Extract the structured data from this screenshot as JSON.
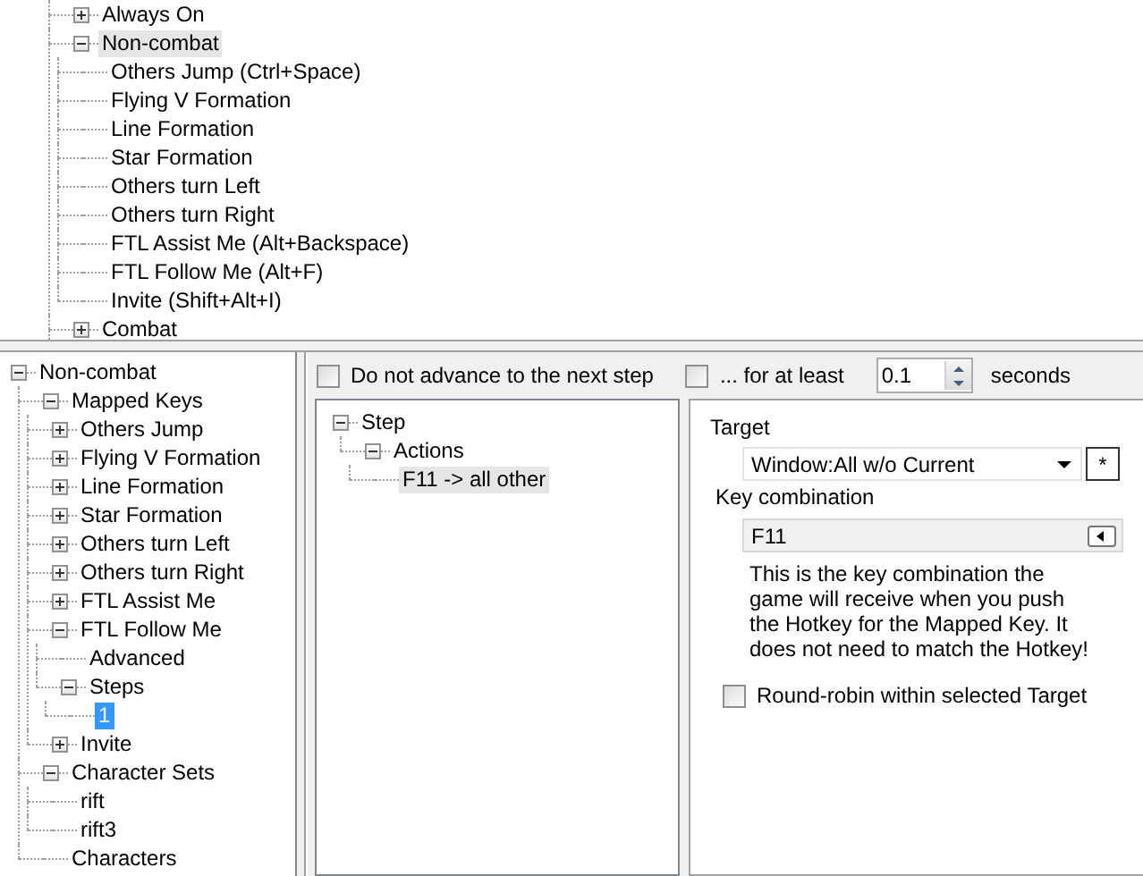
{
  "hotkey_tree": {
    "focused": false,
    "items": [
      {
        "label": "Always On",
        "kind": "folder",
        "expanded": false,
        "selected": false
      },
      {
        "label": "Non-combat",
        "kind": "folder",
        "expanded": true,
        "selected": true,
        "children": [
          {
            "label": "Others Jump (Ctrl+Space)",
            "kind": "leaf",
            "selected": false
          },
          {
            "label": "Flying V Formation",
            "kind": "leaf",
            "selected": false
          },
          {
            "label": "Line Formation",
            "kind": "leaf",
            "selected": false
          },
          {
            "label": "Star Formation",
            "kind": "leaf",
            "selected": false
          },
          {
            "label": "Others turn Left",
            "kind": "leaf",
            "selected": false
          },
          {
            "label": "Others turn Right",
            "kind": "leaf",
            "selected": false
          },
          {
            "label": "FTL Assist Me (Alt+Backspace)",
            "kind": "leaf",
            "selected": false
          },
          {
            "label": "FTL Follow Me (Alt+F)",
            "kind": "leaf",
            "selected": false
          },
          {
            "label": "Invite (Shift+Alt+I)",
            "kind": "leaf",
            "selected": false
          }
        ]
      },
      {
        "label": "Combat",
        "kind": "folder",
        "expanded": false,
        "selected": false
      }
    ]
  },
  "config_tree": {
    "focused": true,
    "items": [
      {
        "label": "Non-combat",
        "kind": "folder",
        "expanded": true,
        "selected": false,
        "children": [
          {
            "label": "Mapped Keys",
            "kind": "folder",
            "expanded": true,
            "selected": false,
            "children": [
              {
                "label": "Others Jump",
                "kind": "folder",
                "expanded": false,
                "selected": false
              },
              {
                "label": "Flying V Formation",
                "kind": "folder",
                "expanded": false,
                "selected": false
              },
              {
                "label": "Line Formation",
                "kind": "folder",
                "expanded": false,
                "selected": false
              },
              {
                "label": "Star Formation",
                "kind": "folder",
                "expanded": false,
                "selected": false
              },
              {
                "label": "Others turn Left",
                "kind": "folder",
                "expanded": false,
                "selected": false
              },
              {
                "label": "Others turn Right",
                "kind": "folder",
                "expanded": false,
                "selected": false
              },
              {
                "label": "FTL Assist Me",
                "kind": "folder",
                "expanded": false,
                "selected": false
              },
              {
                "label": "FTL Follow Me",
                "kind": "folder",
                "expanded": true,
                "selected": false,
                "children": [
                  {
                    "label": "Advanced",
                    "kind": "leaf",
                    "selected": false
                  },
                  {
                    "label": "Steps",
                    "kind": "folder",
                    "expanded": true,
                    "selected": false,
                    "children": [
                      {
                        "label": "1",
                        "kind": "leaf",
                        "selected": true
                      }
                    ]
                  }
                ]
              },
              {
                "label": "Invite",
                "kind": "folder",
                "expanded": false,
                "selected": false
              }
            ]
          },
          {
            "label": "Character Sets",
            "kind": "folder",
            "expanded": true,
            "selected": false,
            "children": [
              {
                "label": "rift",
                "kind": "leaf",
                "selected": false
              },
              {
                "label": "rift3",
                "kind": "leaf",
                "selected": false
              }
            ]
          },
          {
            "label": "Characters",
            "kind": "leaf",
            "selected": false
          }
        ]
      }
    ]
  },
  "step_options": {
    "no_advance": {
      "label": "Do not advance to the next step",
      "checked": false
    },
    "min_time": {
      "label": "... for at least",
      "checked": false
    },
    "seconds_value": "0.1",
    "seconds_label": "seconds"
  },
  "step_tree": {
    "focused": false,
    "items": [
      {
        "label": "Step",
        "kind": "folder",
        "expanded": true,
        "selected": false,
        "children": [
          {
            "label": "Actions",
            "kind": "folder",
            "expanded": true,
            "selected": false,
            "children": [
              {
                "label": "F11 -> all other",
                "kind": "leaf",
                "selected": true
              }
            ]
          }
        ]
      }
    ]
  },
  "action": {
    "target_label": "Target",
    "target_value": "Window:All w/o Current",
    "target_button": "*",
    "key_label": "Key combination",
    "key_value": "F11",
    "description": "This is the key combination the game will receive when you push the Hotkey for the Mapped Key. It does not need to match the Hotkey!",
    "round_robin": {
      "label": "Round-robin within selected Target",
      "checked": false
    }
  }
}
